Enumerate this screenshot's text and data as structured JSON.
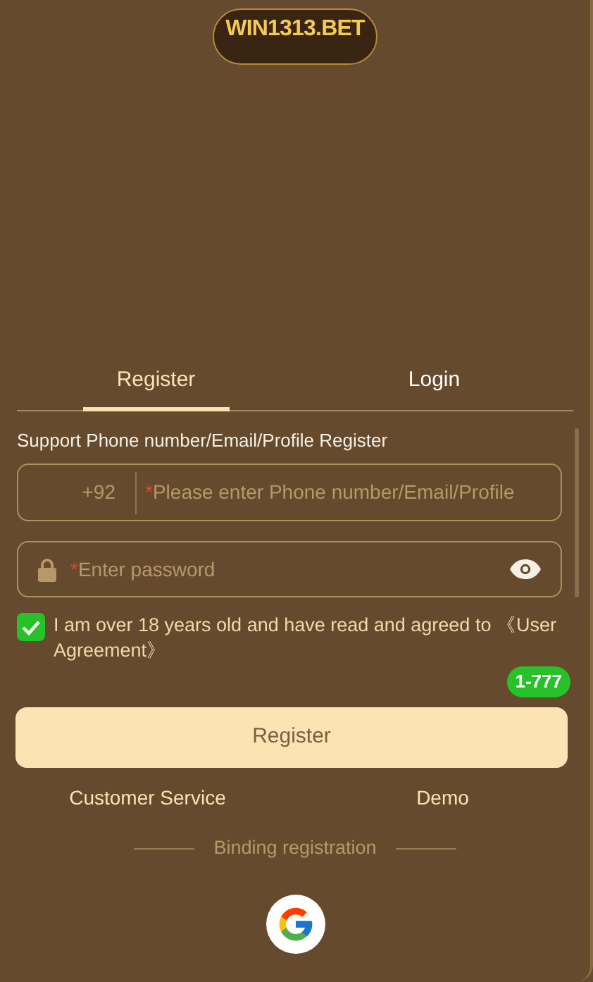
{
  "logo": {
    "text": "WIN1313.BET"
  },
  "tabs": [
    {
      "label": "Register",
      "selected": true
    },
    {
      "label": "Login",
      "selected": false
    }
  ],
  "hint": "Support Phone number/Email/Profile Register",
  "phone_field": {
    "prefix": "+92",
    "mark": "*",
    "placeholder": "Please enter Phone number/Email/Profile"
  },
  "password_field": {
    "mark": "*",
    "placeholder": "Enter password"
  },
  "agreement": {
    "checked": true,
    "text": "I am over 18 years old and have read and agreed to 《User Agreement》"
  },
  "badge": "1-777",
  "submit": "Register",
  "links": [
    "Customer Service",
    "Demo"
  ],
  "divider": "Binding registration",
  "social": [
    {
      "kind": "google"
    }
  ]
}
